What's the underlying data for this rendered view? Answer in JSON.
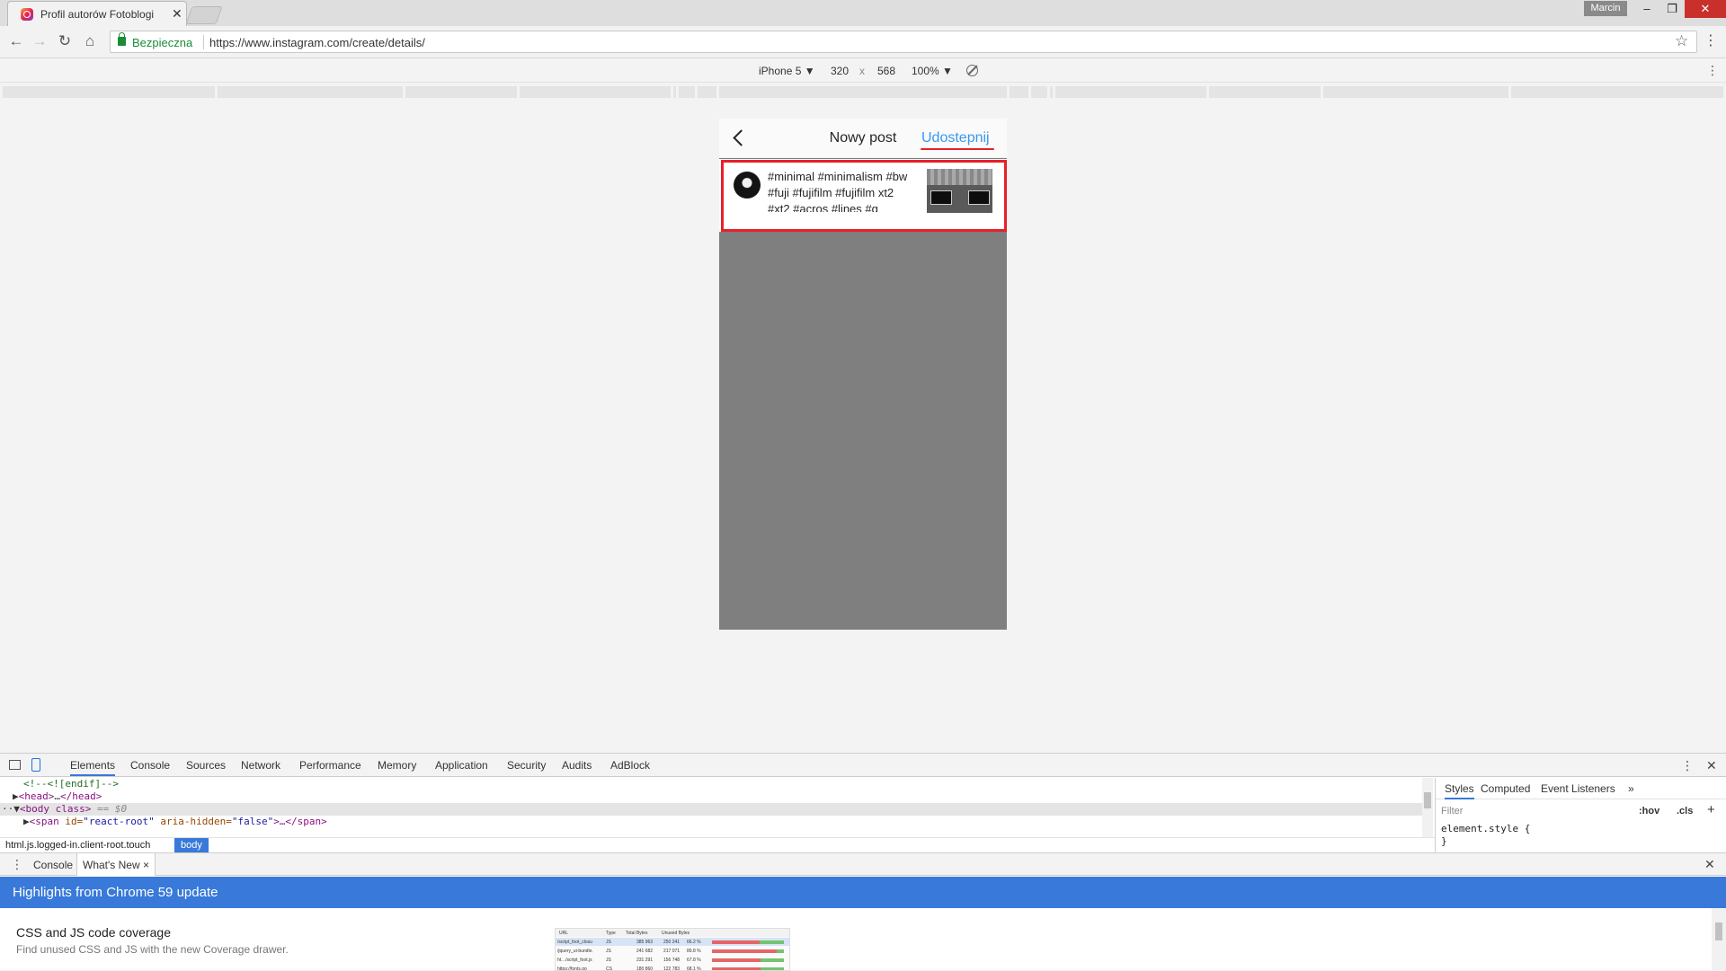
{
  "browser": {
    "tab_title": "Profil autorów Fotoblogi",
    "tab_close": "✕",
    "user": "Marcin",
    "secure_label": "Bezpieczna",
    "url": "https://www.instagram.com/create/details/"
  },
  "device_toolbar": {
    "device": "iPhone 5 ▼",
    "width": "320",
    "times": "x",
    "height": "568",
    "zoom": "100% ▼"
  },
  "phone": {
    "title": "Nowy post",
    "share": "Udostepnij",
    "caption": "#minimal #minimalism #bw #fuji #fujifilm #fujifilm xt2 #xt2 #acros #lines #g"
  },
  "devtools": {
    "tabs": [
      "Elements",
      "Console",
      "Sources",
      "Network",
      "Performance",
      "Memory",
      "Application",
      "Security",
      "Audits",
      "AdBlock"
    ],
    "elements": {
      "line1": "<!--<![endif]-->",
      "line2_tag_open": "<head>",
      "line2_ellipsis": "…",
      "line2_tag_close": "</head>",
      "line3_tag": "<body class>",
      "line3_suffix": " == $0",
      "line4_open": "<span ",
      "line4_attr1": "id=",
      "line4_val1": "\"react-root\"",
      "line4_attr2": " aria-hidden=",
      "line4_val2": "\"false\"",
      "line4_close": ">…</span>"
    },
    "breadcrumbs": [
      "html.js.logged-in.client-root.touch",
      "body"
    ],
    "styles_tabs": [
      "Styles",
      "Computed",
      "Event Listeners",
      "»"
    ],
    "filter_placeholder": "Filter",
    "hov": ":hov",
    "cls": ".cls",
    "plus": "+",
    "element_style_open": "element.style {",
    "element_style_close": "}",
    "drawer_tabs": [
      "Console",
      "What's New"
    ],
    "drawer_tab_close": "×",
    "banner": "Highlights from Chrome 59 update",
    "feature_title": "CSS and JS code coverage",
    "feature_desc": "Find unused CSS and JS with the new Coverage drawer.",
    "coverage": {
      "headers": [
        "URL",
        "Type",
        "Total Bytes",
        "Unused Bytes"
      ],
      "rows": [
        {
          "url": "/script_foot_closu",
          "type": "JS",
          "total": "385 963",
          "unused": "250 241",
          "pct": "66.2 %",
          "unused_frac": 0.66
        },
        {
          "url": "/jquery_ui-bundle.",
          "type": "JS",
          "total": "241 682",
          "unused": "217 071",
          "pct": "89.8 %",
          "unused_frac": 0.9
        },
        {
          "url": "ht…/script_foot.js",
          "type": "JS",
          "total": "231 291",
          "unused": "156 748",
          "pct": "67.8 %",
          "unused_frac": 0.68
        },
        {
          "url": "https://fonts.go",
          "type": "CS",
          "total": "180 860",
          "unused": "122 783",
          "pct": "68.1 %",
          "unused_frac": 0.68
        }
      ]
    }
  }
}
